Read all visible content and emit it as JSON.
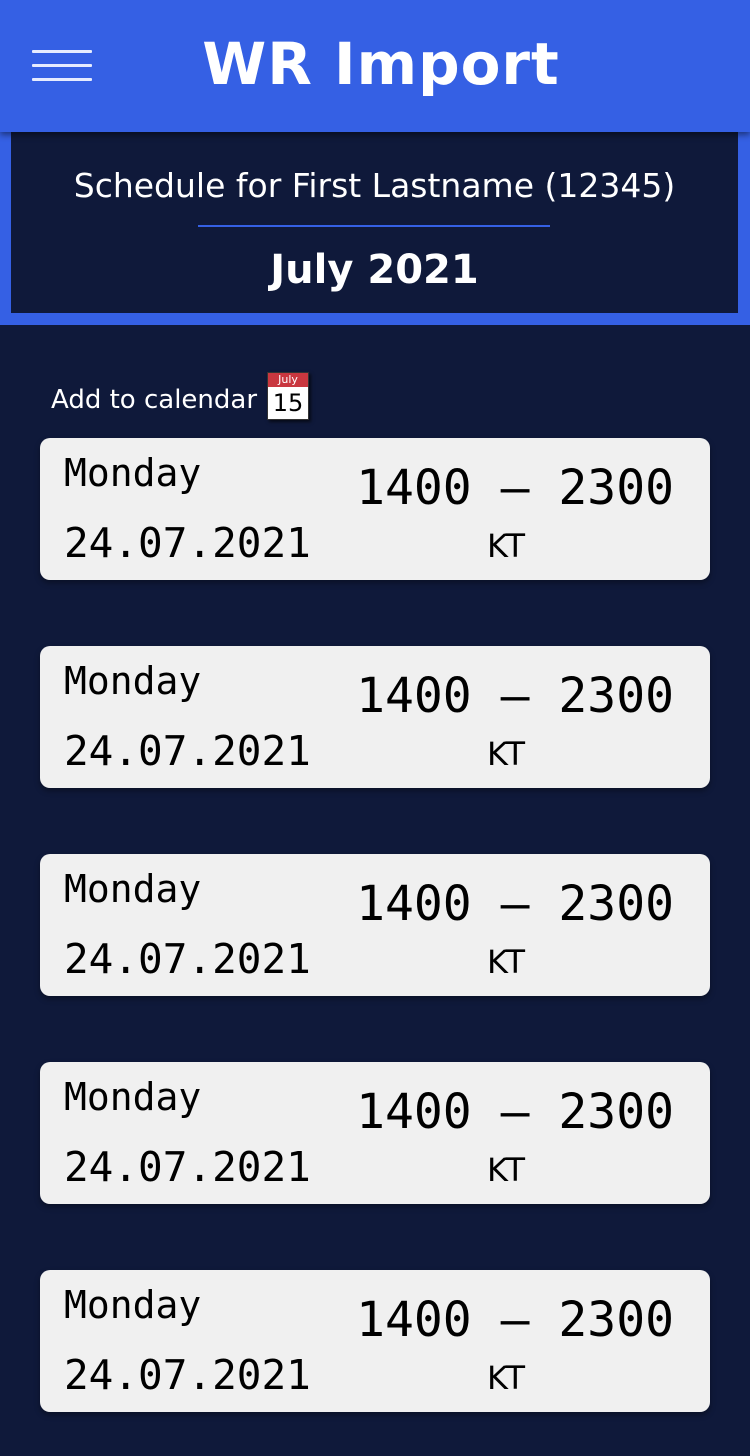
{
  "app": {
    "title": "WR Import",
    "menu_icon": "hamburger-menu-icon"
  },
  "header": {
    "schedule_for": "Schedule for First Lastname (12345)",
    "month": "July 2021"
  },
  "calendar_action": {
    "label": "Add to calendar",
    "icon": "calendar-icon",
    "icon_month": "July",
    "icon_day": "15"
  },
  "shifts": [
    {
      "day": "Monday",
      "date": "24.07.2021",
      "time": "1400 – 2300",
      "code": "KT"
    },
    {
      "day": "Monday",
      "date": "24.07.2021",
      "time": "1400 – 2300",
      "code": "KT"
    },
    {
      "day": "Monday",
      "date": "24.07.2021",
      "time": "1400 – 2300",
      "code": "KT"
    },
    {
      "day": "Monday",
      "date": "24.07.2021",
      "time": "1400 – 2300",
      "code": "KT"
    },
    {
      "day": "Monday",
      "date": "24.07.2021",
      "time": "1400 – 2300",
      "code": "KT"
    }
  ],
  "colors": {
    "primary": "#3560e4",
    "background": "#0f193a",
    "card": "#f0f0f0",
    "calendar_icon_red": "#c9373f"
  }
}
